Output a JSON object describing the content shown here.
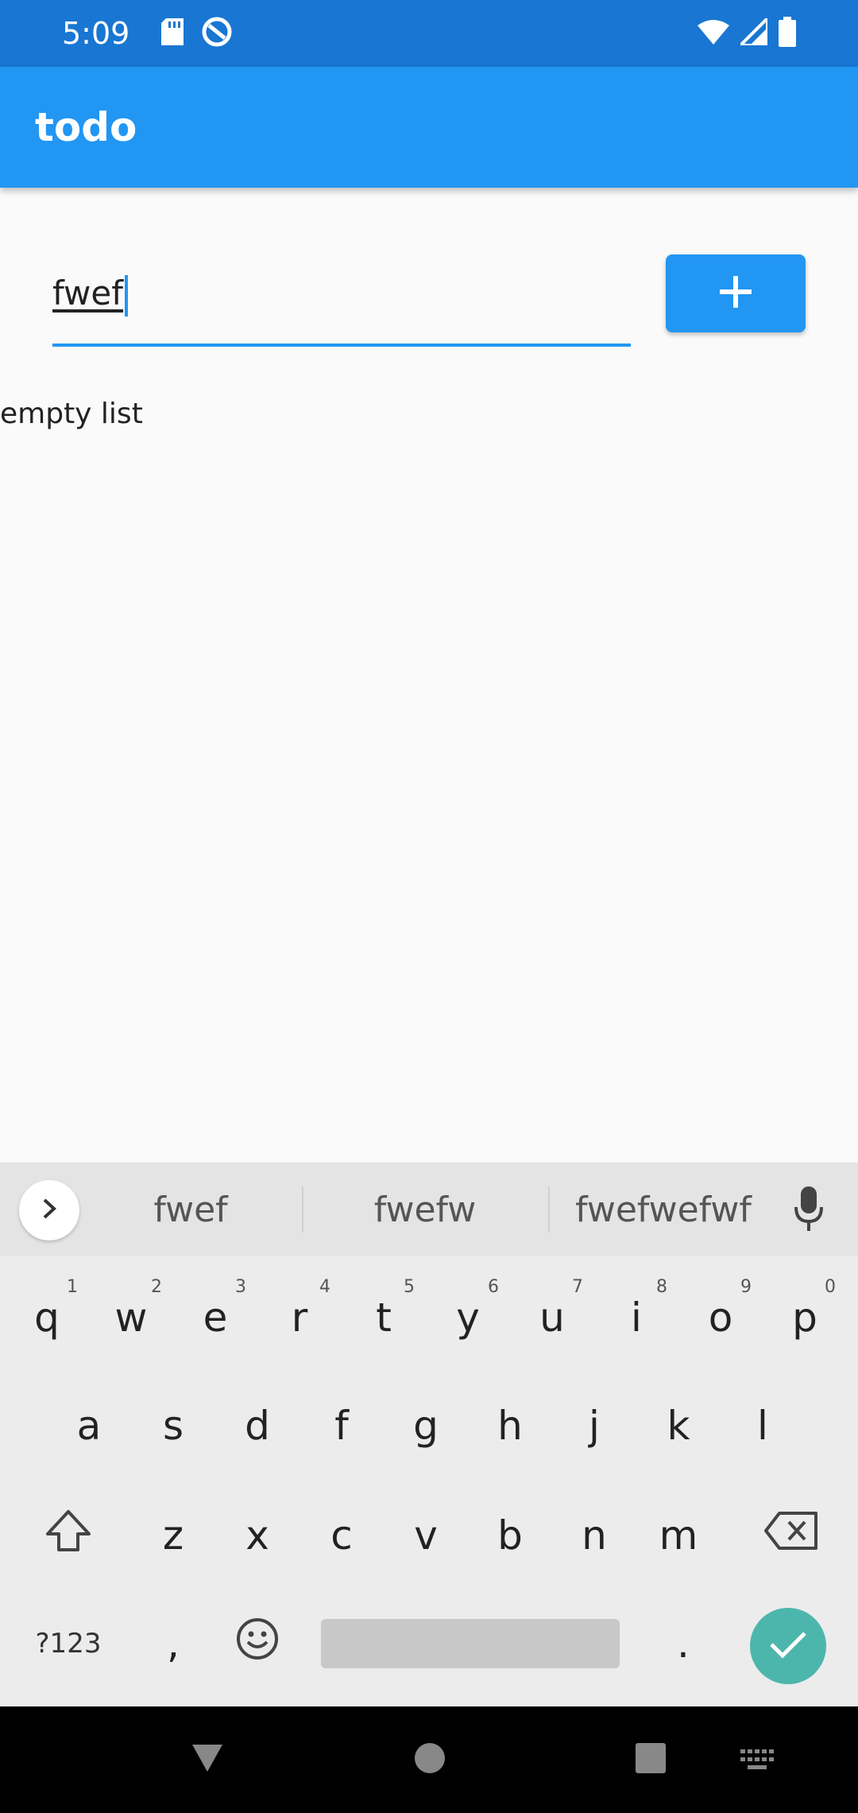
{
  "status_bar": {
    "time": "5:09",
    "icons": [
      "sd-card-icon",
      "sync-icon",
      "wifi-icon",
      "signal-icon",
      "battery-icon"
    ]
  },
  "app_bar": {
    "title": "todo"
  },
  "input": {
    "value": "fwef"
  },
  "add_button": {
    "icon": "plus-icon"
  },
  "list": {
    "empty_text": "empty list"
  },
  "keyboard": {
    "suggestions": [
      "fwef",
      "fwefw",
      "fwefwefwf"
    ],
    "row1": [
      {
        "key": "q",
        "hint": "1"
      },
      {
        "key": "w",
        "hint": "2"
      },
      {
        "key": "e",
        "hint": "3"
      },
      {
        "key": "r",
        "hint": "4"
      },
      {
        "key": "t",
        "hint": "5"
      },
      {
        "key": "y",
        "hint": "6"
      },
      {
        "key": "u",
        "hint": "7"
      },
      {
        "key": "i",
        "hint": "8"
      },
      {
        "key": "o",
        "hint": "9"
      },
      {
        "key": "p",
        "hint": "0"
      }
    ],
    "row2": [
      "a",
      "s",
      "d",
      "f",
      "g",
      "h",
      "j",
      "k",
      "l"
    ],
    "row3": [
      "z",
      "x",
      "c",
      "v",
      "b",
      "n",
      "m"
    ],
    "symbols_label": "?123",
    "comma": ",",
    "period": "."
  },
  "colors": {
    "primary": "#2196f3",
    "status_bar": "#1976d2",
    "enter_key": "#4db6ac"
  }
}
